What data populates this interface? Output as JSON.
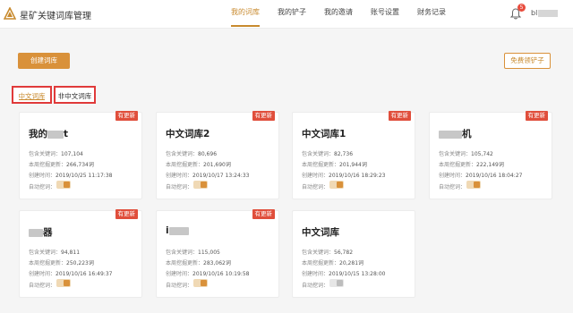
{
  "app": {
    "title": "星矿关键词库管理"
  },
  "nav": [
    {
      "label": "我的词库",
      "active": true
    },
    {
      "label": "我的铲子",
      "active": false
    },
    {
      "label": "我的邀请",
      "active": false
    },
    {
      "label": "账号设置",
      "active": false
    },
    {
      "label": "财务记录",
      "active": false
    }
  ],
  "header": {
    "notification_count": "5",
    "username": "bl"
  },
  "actions": {
    "create_label": "创建词库",
    "free_label": "免费领铲子"
  },
  "tabs": {
    "chinese": "中文词库",
    "non_chinese": "非中文词库"
  },
  "labels": {
    "keywords": "包含关键词：",
    "weekly": "本周挖掘更新：",
    "created": "创建时间：",
    "auto": "自动挖词：",
    "updated": "有更新"
  },
  "cards": [
    {
      "name": "我的",
      "name_suffix": "t",
      "keywords": "107,104",
      "weekly": "266,734词",
      "created": "2019/10/25 11:17:38",
      "updated": true,
      "auto": true
    },
    {
      "name": "中文词库2",
      "name_suffix": "",
      "keywords": "80,696",
      "weekly": "201,690词",
      "created": "2019/10/17 13:24:33",
      "updated": true,
      "auto": true
    },
    {
      "name": "中文词库1",
      "name_suffix": "",
      "keywords": "82,736",
      "weekly": "201,944词",
      "created": "2019/10/16 18:29:23",
      "updated": true,
      "auto": true
    },
    {
      "name": "",
      "name_suffix": "机",
      "keywords": "105,742",
      "weekly": "222,149词",
      "created": "2019/10/16 18:04:27",
      "updated": true,
      "auto": true
    },
    {
      "name": "",
      "name_suffix": "器",
      "keywords": "94,811",
      "weekly": "250,223词",
      "created": "2019/10/16 16:49:37",
      "updated": true,
      "auto": true
    },
    {
      "name": "i",
      "name_suffix": "",
      "keywords": "115,005",
      "weekly": "283,062词",
      "created": "2019/10/16 10:19:58",
      "updated": true,
      "auto": true
    },
    {
      "name": "中文词库",
      "name_suffix": "",
      "keywords": "56,782",
      "weekly": "20,281词",
      "created": "2019/10/15 13:28:00",
      "updated": false,
      "auto": false
    }
  ]
}
